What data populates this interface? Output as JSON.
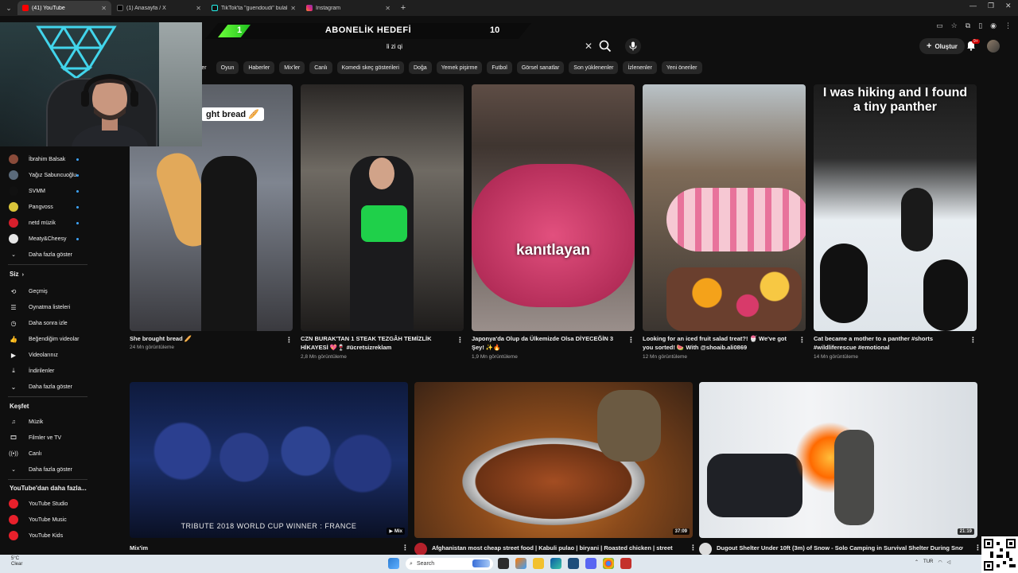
{
  "browser": {
    "tabs": [
      {
        "title": "(41) YouTube",
        "active": true,
        "color": "#ff0000"
      },
      {
        "title": "(1) Anasayfa / X",
        "active": false,
        "color": "#000000"
      },
      {
        "title": "TikTok'ta \"guendoudi\" bulabilirsin",
        "active": false,
        "color": "#111111"
      },
      {
        "title": "Instagram",
        "active": false,
        "color": "#d62976"
      }
    ]
  },
  "goal": {
    "current": "1",
    "title": "ABONELİK HEDEFİ",
    "target": "10",
    "progress": 0.1
  },
  "header": {
    "search_value": "li zi qi",
    "create_label": "Oluştur",
    "notif_count": "9+"
  },
  "chips": [
    "...ler",
    "Oyun",
    "Haberler",
    "Mix'ler",
    "Canlı",
    "Komedi skeç gösterileri",
    "Doğa",
    "Yemek pişirme",
    "Futbol",
    "Görsel sanatlar",
    "Son yüklenenler",
    "İzlenenler",
    "Yeni öneriler"
  ],
  "sidebar": {
    "channels": [
      {
        "name": "İbrahim Balsak",
        "color": "#8a4b3a"
      },
      {
        "name": "Yağız Sabuncuoğlu",
        "color": "#5a6a7a"
      },
      {
        "name": "SVMM",
        "color": "#111111"
      },
      {
        "name": "Pangvoss",
        "color": "#d9c43a"
      },
      {
        "name": "netd müzik",
        "color": "#d61f2c"
      },
      {
        "name": "Meaty&Cheesy",
        "color": "#e6e6e6"
      }
    ],
    "show_more": "Daha fazla göster",
    "you_heading": "Siz",
    "you_items": [
      {
        "label": "Geçmiş",
        "icon": "history-icon"
      },
      {
        "label": "Oynatma listeleri",
        "icon": "playlist-icon"
      },
      {
        "label": "Daha sonra izle",
        "icon": "clock-icon"
      },
      {
        "label": "Beğendiğim videolar",
        "icon": "like-icon"
      },
      {
        "label": "Videolarınız",
        "icon": "video-icon"
      },
      {
        "label": "İndirilenler",
        "icon": "download-icon"
      },
      {
        "label": "Daha fazla göster",
        "icon": "chevron-down-icon"
      }
    ],
    "explore_heading": "Keşfet",
    "explore_items": [
      {
        "label": "Müzik",
        "icon": "music-icon"
      },
      {
        "label": "Filmler ve TV",
        "icon": "film-icon"
      },
      {
        "label": "Canlı",
        "icon": "live-icon"
      },
      {
        "label": "Daha fazla göster",
        "icon": "chevron-down-icon"
      }
    ],
    "more_heading": "YouTube'dan daha fazla...",
    "more_items": [
      {
        "label": "YouTube Studio"
      },
      {
        "label": "YouTube Music"
      },
      {
        "label": "YouTube Kids"
      }
    ]
  },
  "shorts": [
    {
      "title": "She brought bread 🥖",
      "meta": "24 Mn görüntüleme",
      "overlay": "ght bread 🥖"
    },
    {
      "title": "CZN BURAK'TAN 1 STEAK TEZGÂH TEMİZLİK HİKAYESİ 💖🍷 #ücretsizreklam",
      "meta": "2,8 Mn görüntüleme",
      "overlay": ""
    },
    {
      "title": "Japonya'da Olup da Ülkemizde Olsa DİYECEĞİN 3 Şey! ✨🔥",
      "meta": "1,9 Mn görüntüleme",
      "overlay": "kanıtlayan"
    },
    {
      "title": "Looking for an iced fruit salad treat?! 🍧 We've got you sorted! 🍉 With @shoaib.ali0869",
      "meta": "12 Mn görüntüleme",
      "overlay": ""
    },
    {
      "title": "Cat became a mother to a panther #shorts #wildliferescue #emotional",
      "meta": "14 Mn görüntüleme",
      "overlay": "I was hiking and I found a tiny panther"
    }
  ],
  "videos": [
    {
      "title": "Mix'im",
      "overlay": "TRIBUTE 2018 WORLD CUP WINNER : FRANCE",
      "badge": "Mix",
      "duration": ""
    },
    {
      "title": "Afghanistan most cheap street food | Kabuli pulao | biryani | Roasted chicken | street",
      "overlay": "",
      "badge": "",
      "duration": "37:09"
    },
    {
      "title": "Dugout Shelter Under 10ft (3m) of Snow - Solo Camping in Survival Shelter During Snow",
      "overlay": "",
      "badge": "",
      "duration": "21:19"
    }
  ],
  "taskbar": {
    "weather_temp": "5°C",
    "weather_desc": "Clear",
    "search_placeholder": "Search",
    "lang": "TUR"
  }
}
